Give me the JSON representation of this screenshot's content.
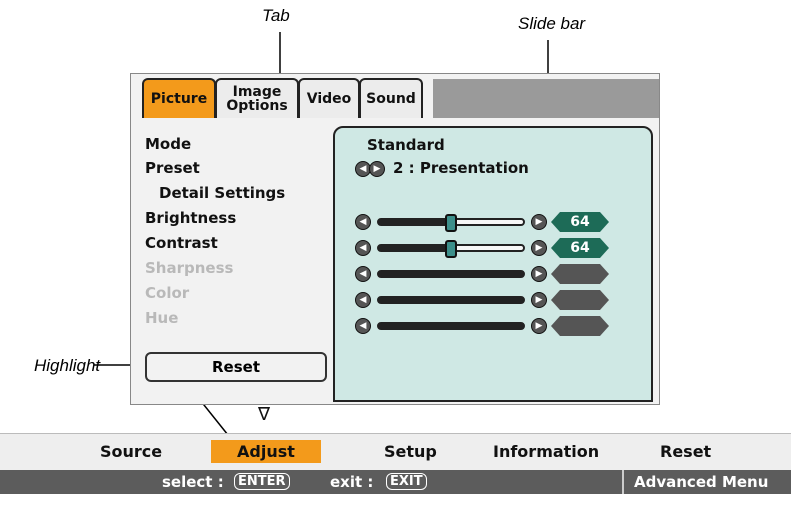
{
  "callouts": {
    "tab": "Tab",
    "slide_bar": "Slide bar",
    "highlight": "Highlight"
  },
  "tabs": [
    {
      "label": "Picture",
      "active": true
    },
    {
      "label_line1": "Image",
      "label_line2": "Options",
      "active": false
    },
    {
      "label": "Video",
      "active": false
    },
    {
      "label": "Sound",
      "active": false
    }
  ],
  "left_items": [
    {
      "label": "Mode",
      "enabled": true
    },
    {
      "label": "Preset",
      "enabled": true
    },
    {
      "label": "Detail Settings",
      "enabled": true
    },
    {
      "label": "Brightness",
      "enabled": true
    },
    {
      "label": "Contrast",
      "enabled": true
    },
    {
      "label": "Sharpness",
      "enabled": false
    },
    {
      "label": "Color",
      "enabled": false
    },
    {
      "label": "Hue",
      "enabled": false
    }
  ],
  "reset_button": "Reset",
  "settings": {
    "mode_value": "Standard",
    "preset_value": "2 : Presentation"
  },
  "sliders": [
    {
      "name": "brightness",
      "value": "64",
      "level": 0.5,
      "enabled": true
    },
    {
      "name": "contrast",
      "value": "64",
      "level": 0.5,
      "enabled": true
    },
    {
      "name": "sharpness",
      "value": "",
      "level": 1.0,
      "enabled": false
    },
    {
      "name": "color",
      "value": "",
      "level": 1.0,
      "enabled": false
    },
    {
      "name": "hue",
      "value": "",
      "level": 1.0,
      "enabled": false
    }
  ],
  "scroll_indicator": "∇",
  "menubar": {
    "items": [
      "Source",
      "Adjust",
      "Setup",
      "Information",
      "Reset"
    ],
    "active_index": 1
  },
  "footer": {
    "select_label": "select :",
    "select_key": "ENTER",
    "exit_label": "exit :",
    "exit_key": "EXIT",
    "mode": "Advanced Menu"
  },
  "colors": {
    "accent": "#f39a1b",
    "panel": "#cfe8e4",
    "value_badge": "#1d6b57"
  }
}
